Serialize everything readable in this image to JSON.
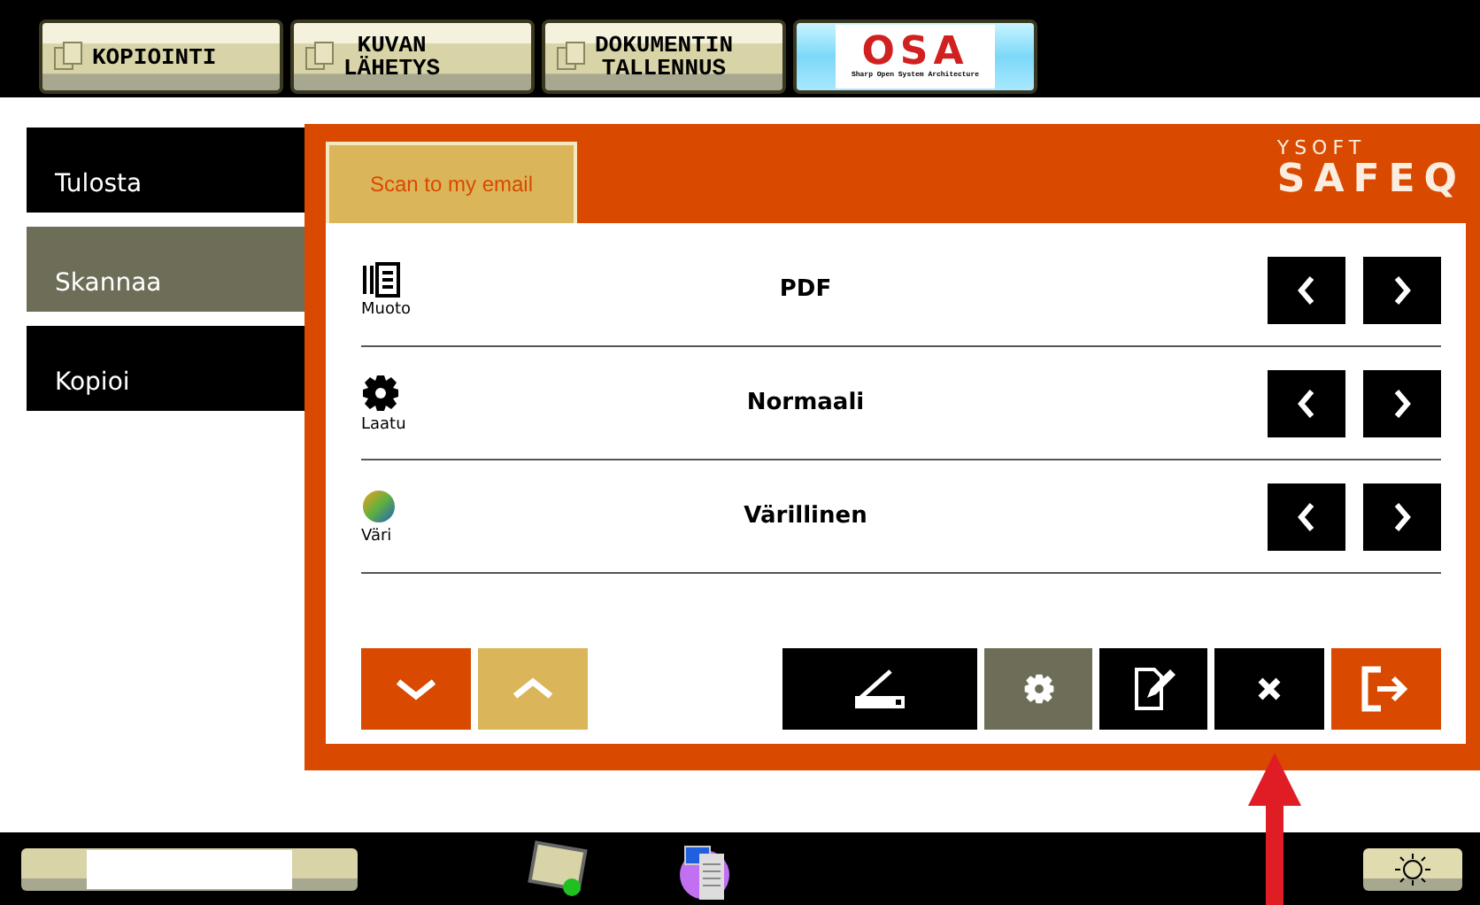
{
  "top_tabs": [
    {
      "kind": "text",
      "label": "KOPIOINTI",
      "selected": false
    },
    {
      "kind": "text",
      "label": "KUVAN LÄHETYS",
      "selected": false
    },
    {
      "kind": "text",
      "label": "DOKUMENTIN TALLENNUS",
      "selected": false
    },
    {
      "kind": "logo",
      "label": "OSA",
      "caption": "Sharp Open System Architecture",
      "selected": true
    }
  ],
  "sidebar": {
    "items": [
      {
        "label": "Tulosta",
        "selected": false
      },
      {
        "label": "Skannaa",
        "selected": true
      },
      {
        "label": "Kopioi",
        "selected": false
      }
    ]
  },
  "panel": {
    "tab": "Scan to my email",
    "brand": {
      "small": "YSOFT",
      "large": "SAFEQ"
    },
    "settings": [
      {
        "kind": "format",
        "label": "Muoto",
        "value": "PDF"
      },
      {
        "kind": "quality",
        "label": "Laatu",
        "value": "Normaali"
      },
      {
        "kind": "color",
        "label": "Väri",
        "value": "Värillinen"
      }
    ],
    "actions": [
      {
        "kind": "scan"
      },
      {
        "kind": "settings"
      },
      {
        "kind": "edit"
      },
      {
        "kind": "close"
      },
      {
        "kind": "exit"
      }
    ]
  },
  "annotation": {
    "kind": "arrow"
  }
}
